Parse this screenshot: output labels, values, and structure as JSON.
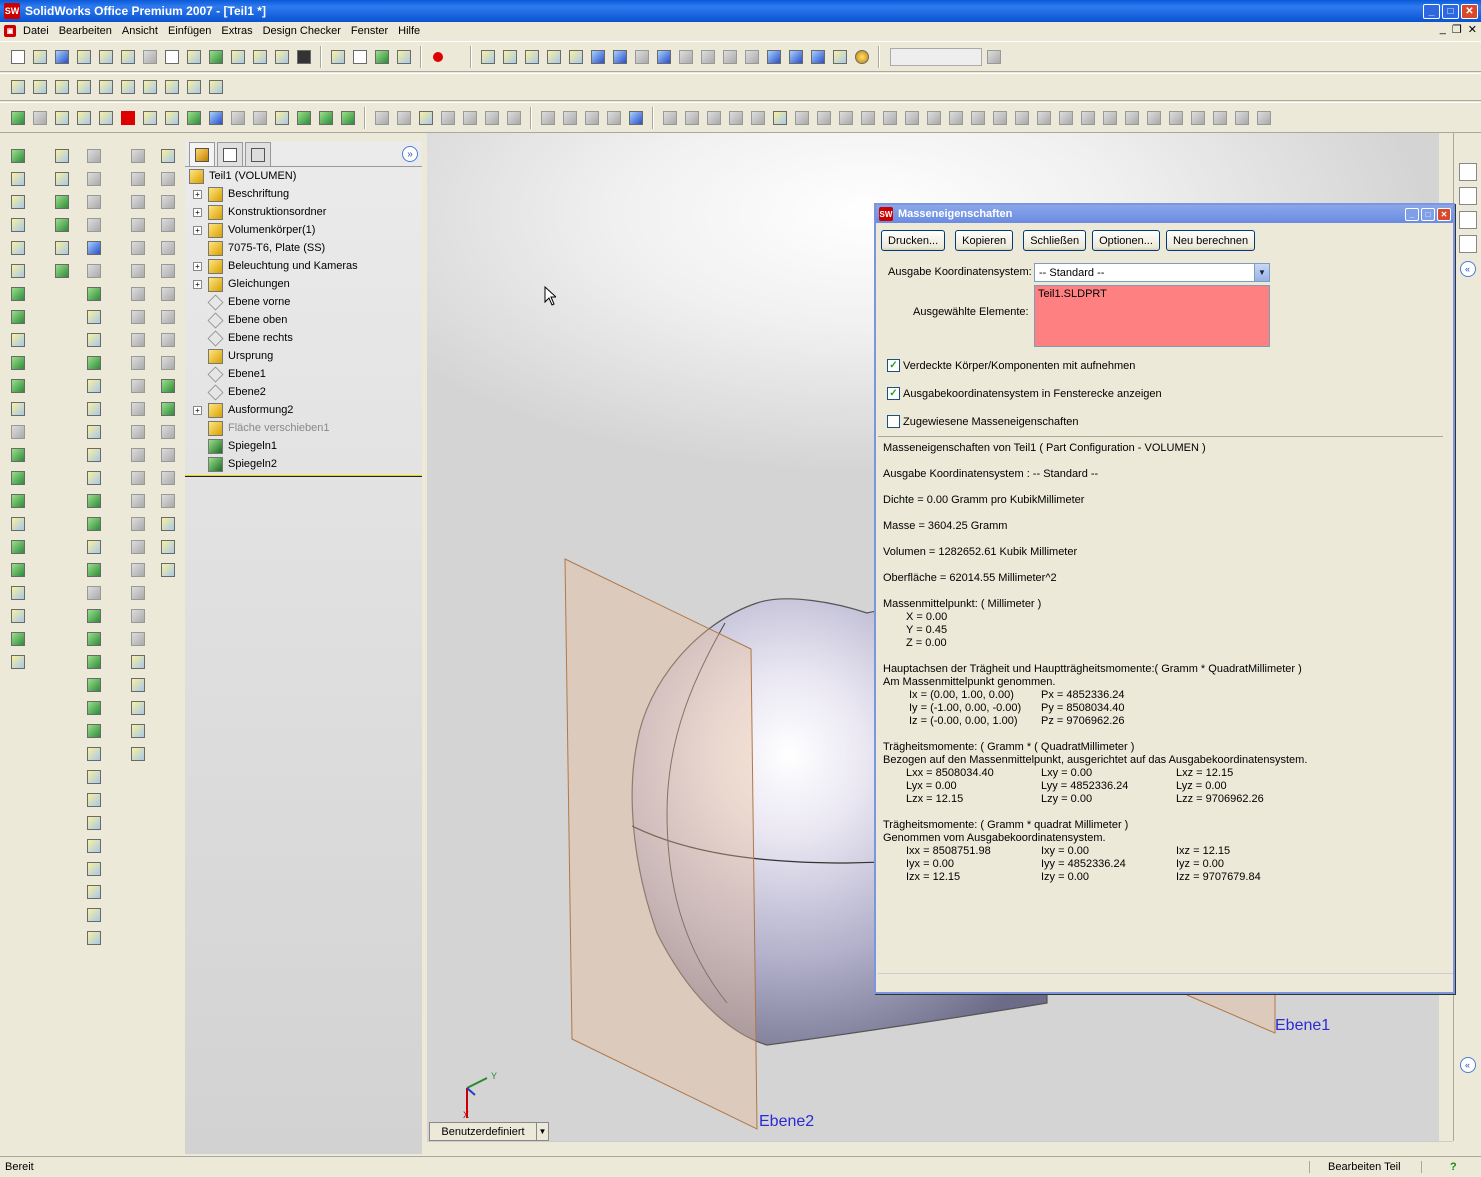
{
  "window": {
    "title": "SolidWorks Office Premium 2007 - [Teil1 *]",
    "logo": "SW"
  },
  "menu": [
    "Datei",
    "Bearbeiten",
    "Ansicht",
    "Einfügen",
    "Extras",
    "Design Checker",
    "Fenster",
    "Hilfe"
  ],
  "tree": {
    "root": "Teil1  (VOLUMEN)",
    "items": [
      {
        "label": "Beschriftung",
        "expand": true,
        "icon": "annotation-icon"
      },
      {
        "label": "Konstruktionsordner",
        "expand": true,
        "icon": "design-folder-icon"
      },
      {
        "label": "Volumenkörper(1)",
        "expand": true,
        "icon": "solid-bodies-icon"
      },
      {
        "label": "7075-T6, Plate (SS)",
        "expand": false,
        "icon": "material-icon"
      },
      {
        "label": "Beleuchtung und Kameras",
        "expand": true,
        "icon": "lights-icon"
      },
      {
        "label": "Gleichungen",
        "expand": true,
        "icon": "equations-icon"
      },
      {
        "label": "Ebene vorne",
        "expand": false,
        "icon": "plane-icon"
      },
      {
        "label": "Ebene oben",
        "expand": false,
        "icon": "plane-icon"
      },
      {
        "label": "Ebene rechts",
        "expand": false,
        "icon": "plane-icon"
      },
      {
        "label": "Ursprung",
        "expand": false,
        "icon": "origin-icon"
      },
      {
        "label": "Ebene1",
        "expand": false,
        "icon": "plane-icon"
      },
      {
        "label": "Ebene2",
        "expand": false,
        "icon": "plane-icon"
      },
      {
        "label": "Ausformung2",
        "expand": true,
        "icon": "loft-icon"
      },
      {
        "label": "Fläche verschieben1",
        "expand": false,
        "icon": "move-face-icon",
        "suppressed": true
      },
      {
        "label": "Spiegeln1",
        "expand": false,
        "icon": "mirror-icon"
      },
      {
        "label": "Spiegeln2",
        "expand": false,
        "icon": "mirror-icon"
      }
    ]
  },
  "viewport": {
    "labels": {
      "ebene1": "Ebene1",
      "ebene2": "Ebene2"
    },
    "axes": {
      "x": "X",
      "y": "Y"
    },
    "view_combo": "Benutzerdefiniert"
  },
  "status": {
    "text": "Bereit",
    "mode": "Bearbeiten Teil",
    "help": "?"
  },
  "dialog": {
    "title": "Masseneigenschaften",
    "buttons": [
      "Drucken...",
      "Kopieren",
      "Schließen",
      "Optionen...",
      "Neu berechnen"
    ],
    "coord_label": "Ausgabe Koordinatensystem:",
    "coord_value": "-- Standard --",
    "selected_label": "Ausgewählte Elemente:",
    "selected_value": "Teil1.SLDPRT",
    "selected_bg": "#ff8080",
    "checkboxes": [
      {
        "label": "Verdeckte Körper/Komponenten mit aufnehmen",
        "checked": true
      },
      {
        "label": "Ausgabekoordinatensystem in Fensterecke anzeigen",
        "checked": true
      },
      {
        "label": "Zugewiesene Masseneigenschaften",
        "checked": false
      }
    ],
    "results": {
      "header": "Masseneigenschaften von Teil1 ( Part Configuration - VOLUMEN )",
      "coord": "Ausgabe Koordinatensystem : -- Standard --",
      "density": "Dichte = 0.00 Gramm pro KubikMillimeter",
      "mass": "Masse = 3604.25 Gramm",
      "volume": "Volumen = 1282652.61 Kubik Millimeter",
      "surface": "Oberfläche = 62014.55 Millimeter^2",
      "com_title": "Massenmittelpunkt: ( Millimeter )",
      "com": [
        "X = 0.00",
        "Y = 0.45",
        "Z = 0.00"
      ],
      "principal_title": "Hauptachsen der Trägheit und Hauptträgheitsmomente:( Gramm * QuadratMillimeter )",
      "principal_sub": "Am Massenmittelpunkt genommen.",
      "principal": [
        [
          "Ix = (0.00, 1.00, 0.00)",
          "Px = 4852336.24"
        ],
        [
          "Iy = (-1.00, 0.00, -0.00)",
          "Py = 8508034.40"
        ],
        [
          "Iz = (-0.00, 0.00, 1.00)",
          "Pz = 9706962.26"
        ]
      ],
      "inertia1_title": "Trägheitsmomente: ( Gramm * ( QuadratMillimeter )",
      "inertia1_sub": "Bezogen auf den Massenmittelpunkt, ausgerichtet auf das Ausgabekoordinatensystem.",
      "inertia1": [
        [
          "Lxx = 8508034.40",
          "Lxy = 0.00",
          "Lxz = 12.15"
        ],
        [
          "Lyx = 0.00",
          "Lyy = 4852336.24",
          "Lyz = 0.00"
        ],
        [
          "Lzx = 12.15",
          "Lzy = 0.00",
          "Lzz = 9706962.26"
        ]
      ],
      "inertia2_title": "Trägheitsmomente: ( Gramm * quadrat Millimeter )",
      "inertia2_sub": "Genommen vom Ausgabekoordinatensystem.",
      "inertia2": [
        [
          "Ixx = 8508751.98",
          "Ixy = 0.00",
          "Ixz = 12.15"
        ],
        [
          "Iyx = 0.00",
          "Iyy = 4852336.24",
          "Iyz = 0.00"
        ],
        [
          "Izx = 12.15",
          "Izy = 0.00",
          "Izz = 9707679.84"
        ]
      ]
    }
  }
}
